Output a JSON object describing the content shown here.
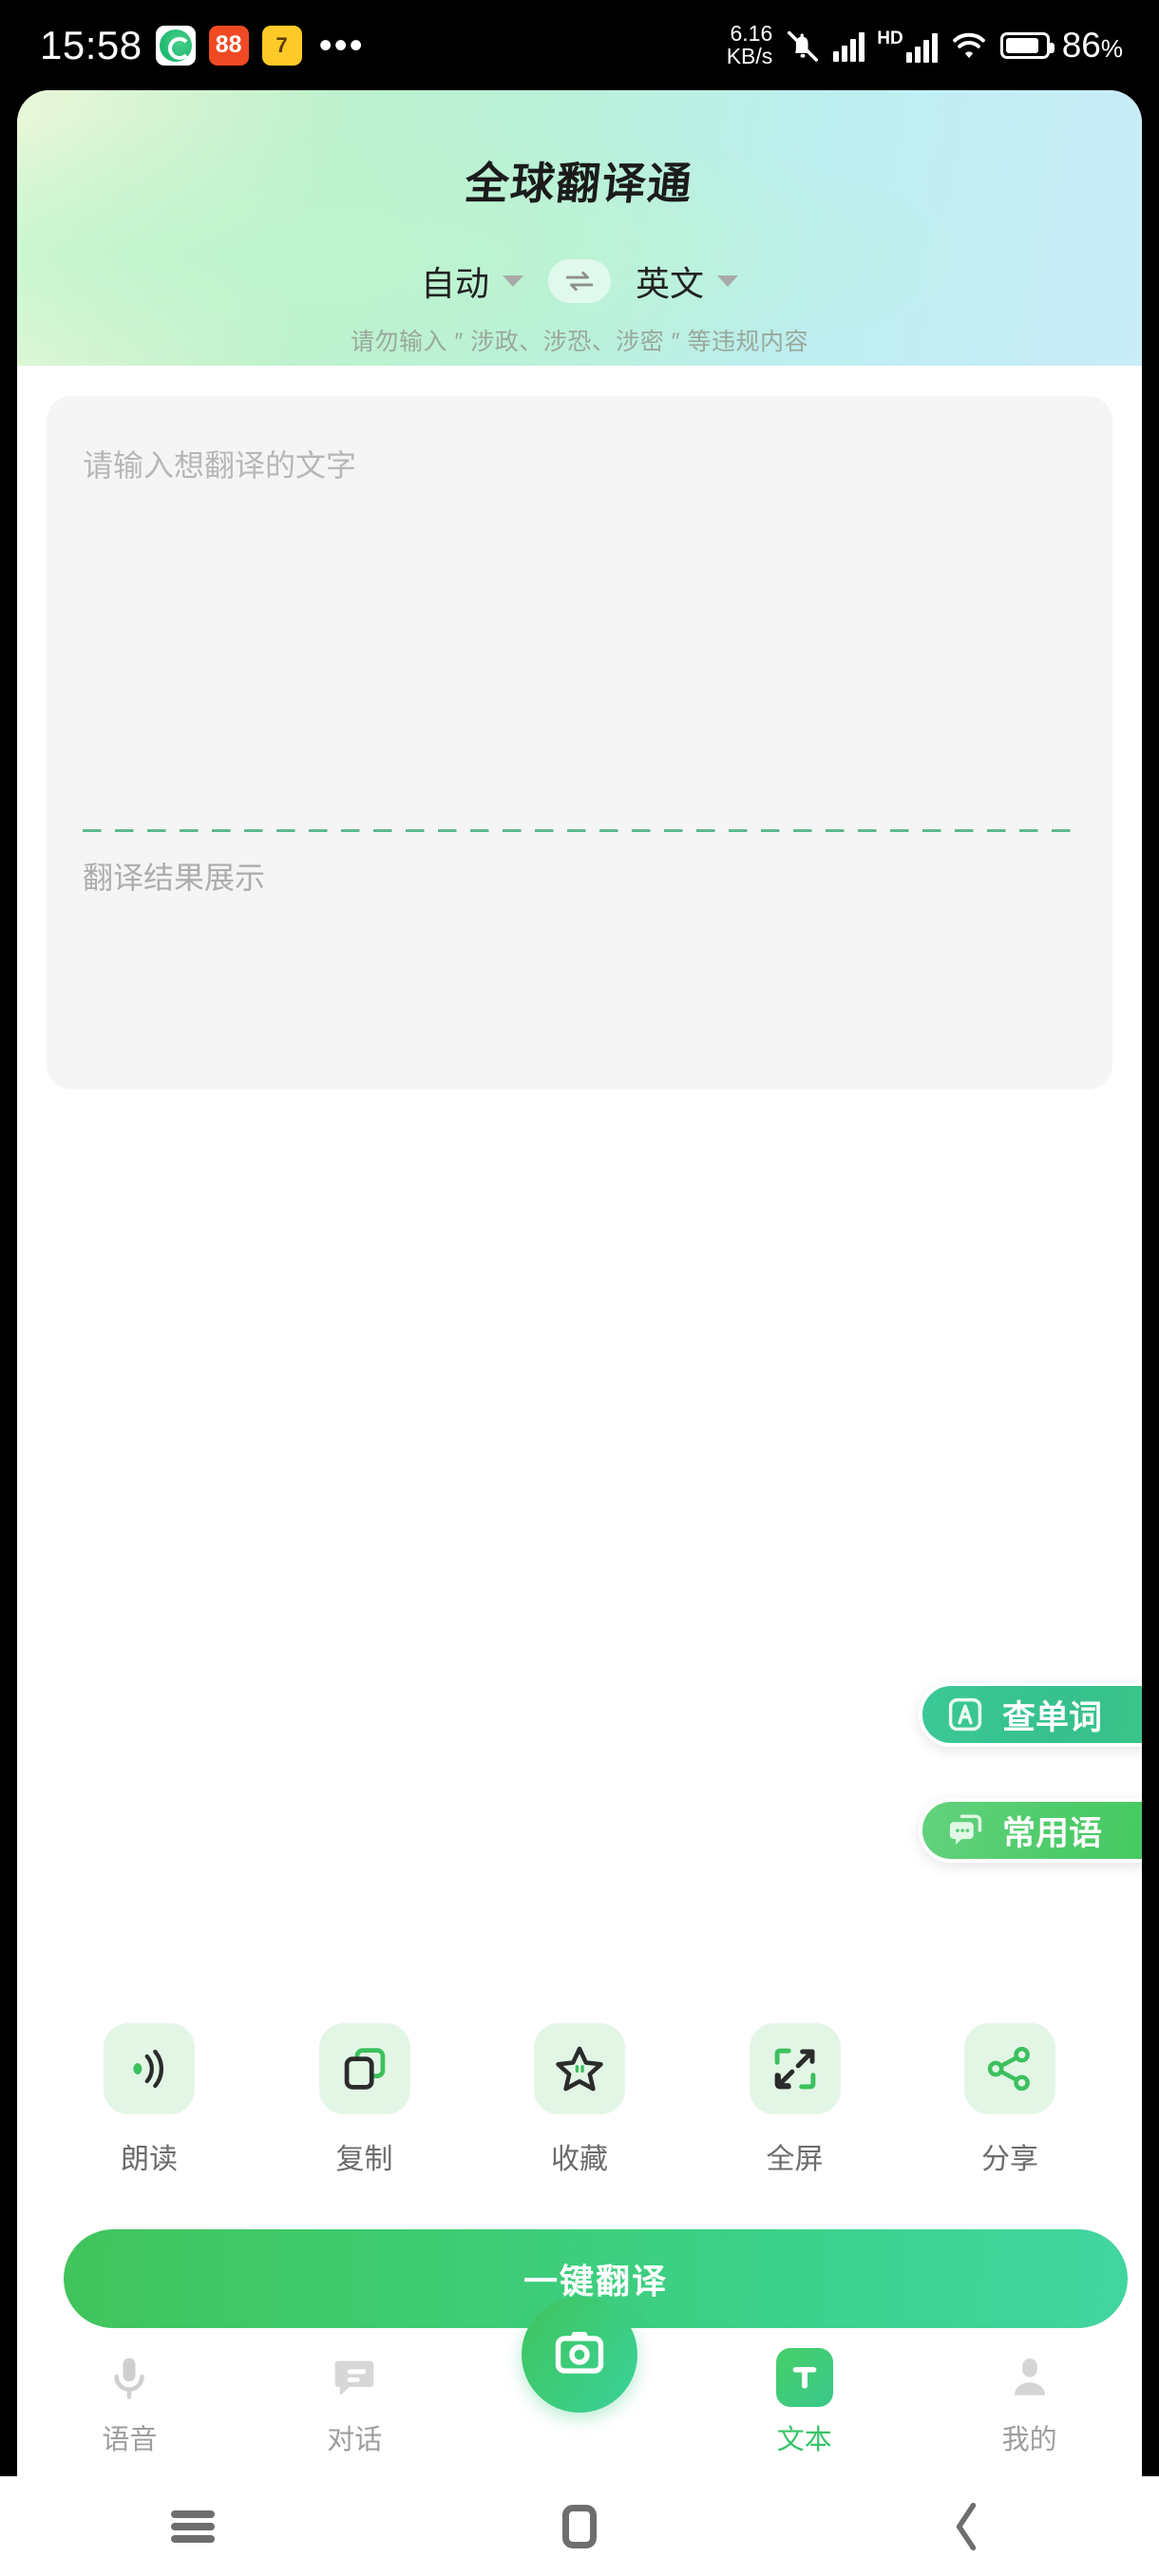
{
  "status_bar": {
    "time": "15:58",
    "app_icons": [
      {
        "name": "camera-green-app-icon",
        "glyph": ""
      },
      {
        "name": "orange-app-icon",
        "glyph": "88"
      },
      {
        "name": "yellow-app-icon",
        "glyph": "7"
      }
    ],
    "more_dots": "•••",
    "net_speed_value": "6.16",
    "net_speed_unit": "KB/s",
    "hd_label": "HD",
    "battery_percent": "86",
    "battery_percent_symbol": "%",
    "battery_level": 86
  },
  "header": {
    "title": "全球翻译通",
    "source_language": "自动",
    "target_language": "英文",
    "swap_icon": "swap-horizontal-icon",
    "notice": "请勿输入 ″ 涉政、涉恐、涉密 ″ 等违规内容",
    "gradient_start": "#e9f7d8",
    "gradient_end": "#c9ecf7"
  },
  "editor": {
    "source_placeholder": "请输入想翻译的文字",
    "source_value": "",
    "result_placeholder": "翻译结果展示",
    "result_value": "",
    "card_bg": "#f5f5f5",
    "divider_color": "#5cb98e"
  },
  "floating_pills": [
    {
      "name": "lookup-word",
      "label": "查单词",
      "icon": "letter-a-box-icon",
      "color": "#37c391"
    },
    {
      "name": "common-phrases",
      "label": "常用语",
      "icon": "chat-bubble-dots-icon",
      "color": "#4aca66"
    }
  ],
  "actions": [
    {
      "label": "朗读",
      "icon": "speaker-waves-icon"
    },
    {
      "label": "复制",
      "icon": "copy-icon"
    },
    {
      "label": "收藏",
      "icon": "star-icon"
    },
    {
      "label": "全屏",
      "icon": "fullscreen-expand-icon"
    },
    {
      "label": "分享",
      "icon": "share-nodes-icon"
    }
  ],
  "translate_button": {
    "label": "一键翻译",
    "gradient_start": "#41c45c",
    "gradient_end": "#42d5a0"
  },
  "bottom_nav": {
    "items": [
      {
        "label": "语音",
        "icon": "microphone-icon",
        "active": false
      },
      {
        "label": "对话",
        "icon": "chat-lines-icon",
        "active": false
      },
      {
        "label": "文本",
        "icon": "text-t-icon",
        "active": true
      },
      {
        "label": "我的",
        "icon": "user-profile-icon",
        "active": false
      }
    ],
    "center_button": {
      "name": "camera-translate-fab",
      "icon": "camera-icon"
    },
    "active_color": "#38c46a",
    "inactive_color": "#9e9e9e"
  },
  "system_nav": {
    "recents": "recents-icon",
    "home": "home-icon",
    "back": "back-chevron-icon"
  }
}
